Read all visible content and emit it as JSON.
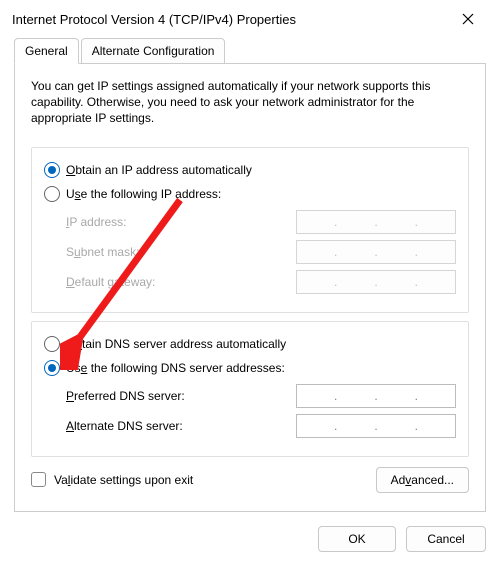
{
  "window": {
    "title": "Internet Protocol Version 4 (TCP/IPv4) Properties"
  },
  "tabs": {
    "general": "General",
    "alternate": "Alternate Configuration"
  },
  "intro": "You can get IP settings assigned automatically if your network supports this capability. Otherwise, you need to ask your network administrator for the appropriate IP settings.",
  "ip": {
    "auto_prefix": "O",
    "auto_rest": "btain an IP address automatically",
    "manual_prefix": "U",
    "manual_mid": "se the following IP address",
    "manual_colon": ":",
    "ip_lbl_prefix": "I",
    "ip_lbl_rest": "P address:",
    "subnet_lbl_prefix": "S",
    "subnet_lbl_rest": "ubnet mask:",
    "gateway_lbl_prefix": "D",
    "gateway_lbl_rest": "efault gateway:",
    "auto_checked": true
  },
  "dns": {
    "auto_prefix": "O",
    "auto_rest1": "btain DNS server address automatically",
    "manual_prefix": "Us",
    "manual_under": "e",
    "manual_rest": " the following DNS server addresses:",
    "pref_lbl_prefix": "P",
    "pref_lbl_rest": "referred DNS server:",
    "alt_lbl_prefix": "A",
    "alt_lbl_rest": "lternate DNS server:",
    "manual_checked": true
  },
  "validate": {
    "prefix": "V",
    "rest": "alidate settings upon exit"
  },
  "buttons": {
    "advanced_prefix": "Ad",
    "advanced_under": "v",
    "advanced_rest": "anced...",
    "ok": "OK",
    "cancel": "Cancel"
  }
}
